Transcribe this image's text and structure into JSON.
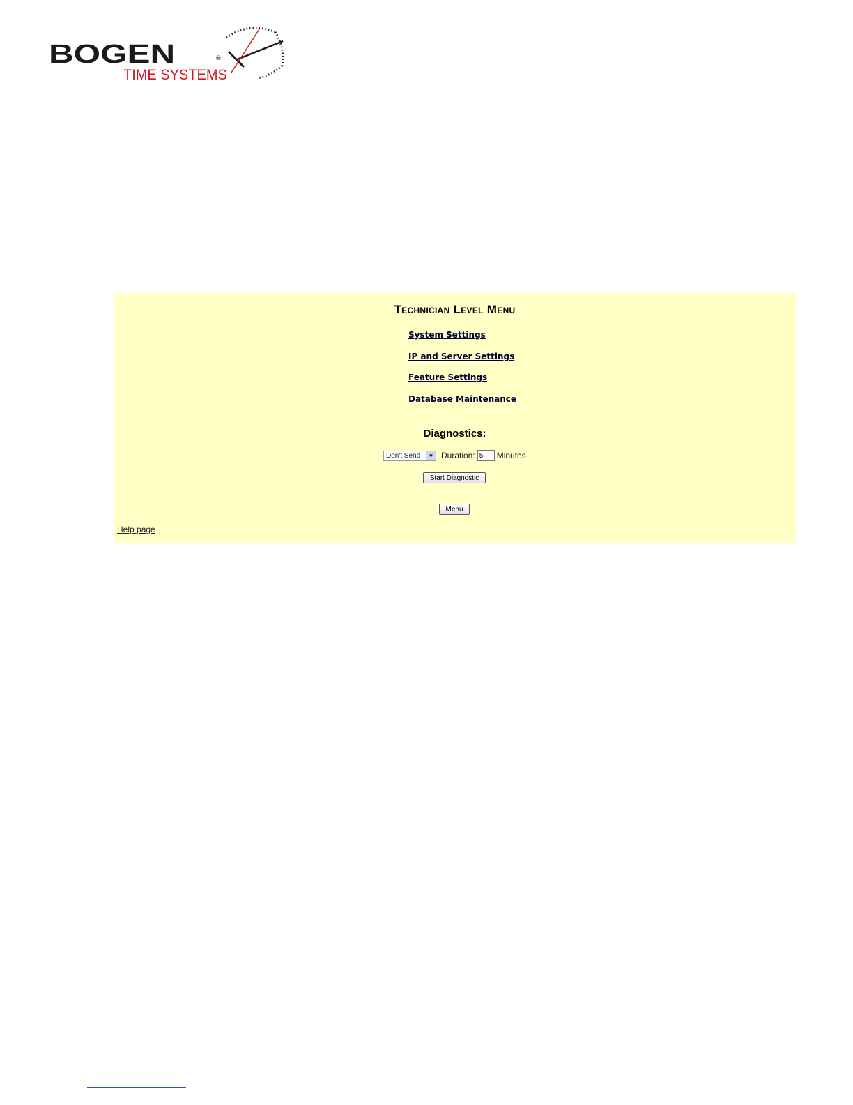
{
  "brand": {
    "name": "BOGEN",
    "tagline": "TIME SYSTEMS",
    "registered_mark": "®",
    "colors": {
      "name": "#1a1a1a",
      "tagline": "#d4161c",
      "second_hand": "#d4161c"
    }
  },
  "panel": {
    "title": "Technician Level Menu",
    "background": "#ffffc6",
    "links": [
      {
        "label": "System Settings"
      },
      {
        "label": "IP and Server Settings"
      },
      {
        "label": "Feature Settings"
      },
      {
        "label": "Database Maintenance"
      }
    ]
  },
  "diagnostics": {
    "title": "Diagnostics:",
    "select_value": "Don't Send",
    "duration_label": "Duration:",
    "duration_value": "5",
    "unit_label": "Minutes",
    "start_button": "Start Diagnostic"
  },
  "menu_button": "Menu",
  "help_link": "Help page",
  "icons": {
    "select_arrow": "chevron-down-icon",
    "clock": "clock-icon"
  }
}
